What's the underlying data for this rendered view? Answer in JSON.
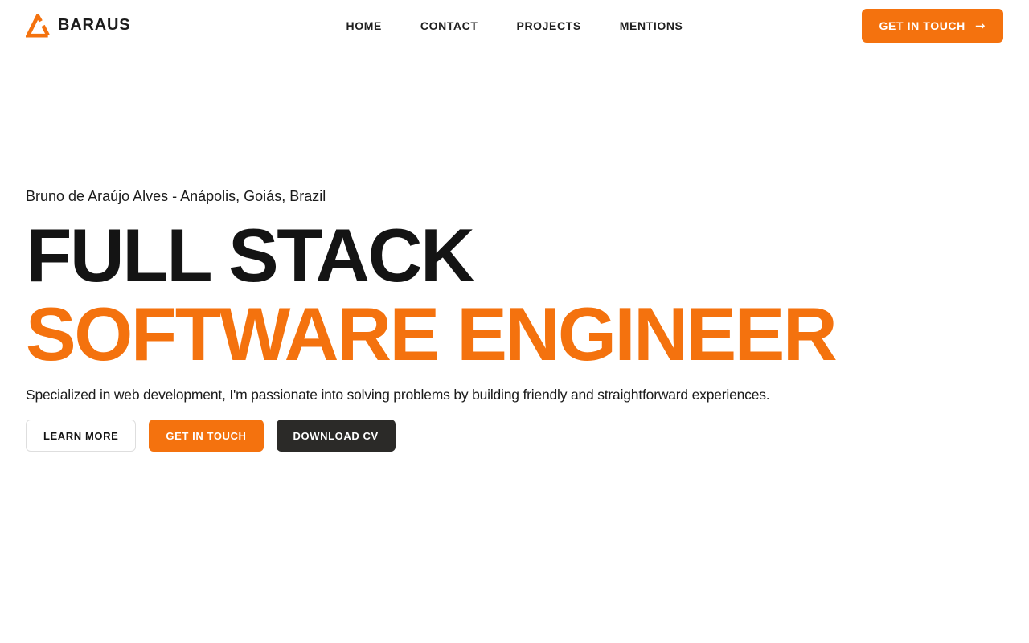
{
  "brand": {
    "name": "BARAUS",
    "logo_icon": "triangle-delta-logo"
  },
  "nav": {
    "items": [
      "HOME",
      "CONTACT",
      "PROJECTS",
      "MENTIONS"
    ],
    "cta": {
      "label": "GET IN TOUCH",
      "arrow_icon": "→"
    }
  },
  "hero": {
    "intro": "Bruno de Araújo Alves - Anápolis, Goiás, Brazil",
    "title_line1": "FULL STACK",
    "title_line2": "SOFTWARE ENGINEER",
    "subtitle": "Specialized in web development, I'm passionate into solving problems by building friendly and straightforward experiences.",
    "buttons": {
      "learn_more": "LEARN MORE",
      "get_in_touch": "GET IN TOUCH",
      "download_cv": "DOWNLOAD CV"
    }
  },
  "colors": {
    "accent": "#f4720e",
    "dark_button": "#2b2a28",
    "heading_text": "#141414",
    "header_border": "#e7e7e7",
    "background": "#ffffff"
  }
}
